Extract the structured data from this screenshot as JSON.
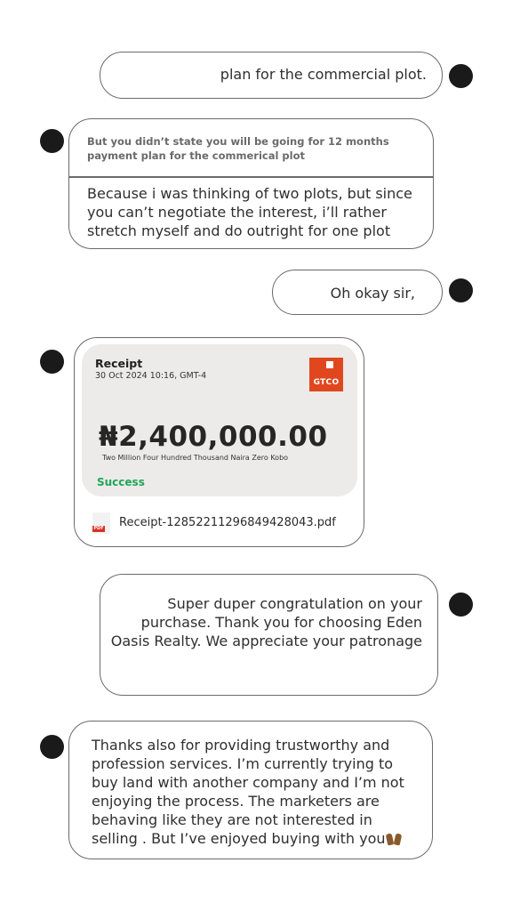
{
  "messages": [
    {
      "id": "m1",
      "side": "sent",
      "text": "plan for the commercial plot."
    },
    {
      "id": "m2",
      "side": "received",
      "quote": "But you didn’t state you will be going for 12 months payment plan for the commerical plot",
      "text": "Because i was thinking of two plots, but since you can’t negotiate the interest, i’ll rather stretch myself and do outright for one plot"
    },
    {
      "id": "m3",
      "side": "sent",
      "text": "Oh okay sir,"
    },
    {
      "id": "m4",
      "side": "received",
      "receipt": {
        "title": "Receipt",
        "date": "30 Oct 2024 10:16, GMT-4",
        "bank_logo": "GTCO",
        "amount": "₦2,400,000.00",
        "amount_words": "Two Million Four Hundred Thousand Naira Zero Kobo",
        "status": "Success",
        "status_color": "#21a556",
        "logo_color": "#e1471f"
      },
      "attachment": {
        "icon": "pdf-file-icon",
        "icon_tag": "PDF",
        "filename": "Receipt-128522112968494280​43.pdf"
      }
    },
    {
      "id": "m5",
      "side": "sent",
      "text": "Super duper congratulation on your purchase. Thank you for choosing Eden Oasis Realty. We appreciate your patronage"
    },
    {
      "id": "m6",
      "side": "received",
      "text": "Thanks also for providing trustworthy and profession services. I’m currently trying to buy land with another company and I’m not enjoying the process. The marketers are behaving like they are not interested in selling . But I’ve enjoyed buying with you",
      "emoji": "raised-hands-icon"
    }
  ]
}
